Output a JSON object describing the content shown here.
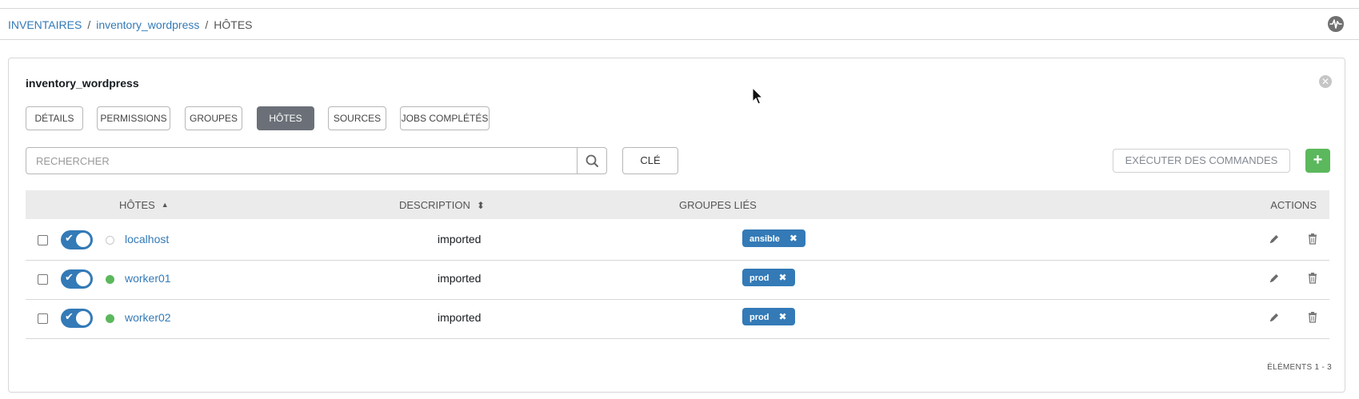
{
  "breadcrumb": {
    "items": [
      "INVENTAIRES",
      "inventory_wordpress"
    ],
    "separator": "/",
    "current": "HÔTES"
  },
  "header": {
    "activity_icon": "activity-stream-icon"
  },
  "panel": {
    "title": "inventory_wordpress",
    "close_icon": "close-icon",
    "tabs": [
      {
        "label": "DÉTAILS",
        "active": false
      },
      {
        "label": "PERMISSIONS",
        "active": false
      },
      {
        "label": "GROUPES",
        "active": false
      },
      {
        "label": "HÔTES",
        "active": true
      },
      {
        "label": "SOURCES",
        "active": false
      },
      {
        "label": "JOBS COMPLÉTÉS",
        "active": false
      }
    ]
  },
  "toolbar": {
    "search_placeholder": "RECHERCHER",
    "search_icon": "search-icon",
    "key_label": "CLÉ",
    "run_commands_label": "EXÉCUTER DES COMMANDES",
    "add_label": "+"
  },
  "table": {
    "columns": {
      "hosts": "HÔTES",
      "description": "DESCRIPTION",
      "groups": "GROUPES LIÉS",
      "actions": "ACTIONS"
    },
    "rows": [
      {
        "name": "localhost",
        "description": "imported",
        "group": "ansible",
        "enabled": true,
        "status": "inactive"
      },
      {
        "name": "worker01",
        "description": "imported",
        "group": "prod",
        "enabled": true,
        "status": "ok"
      },
      {
        "name": "worker02",
        "description": "imported",
        "group": "prod",
        "enabled": true,
        "status": "ok"
      }
    ]
  },
  "pagination": {
    "label": "ÉLÉMENTS  1 - 3"
  },
  "colors": {
    "accent": "#337ab7",
    "success": "#5cb85c",
    "active_tab": "#6b7078"
  }
}
